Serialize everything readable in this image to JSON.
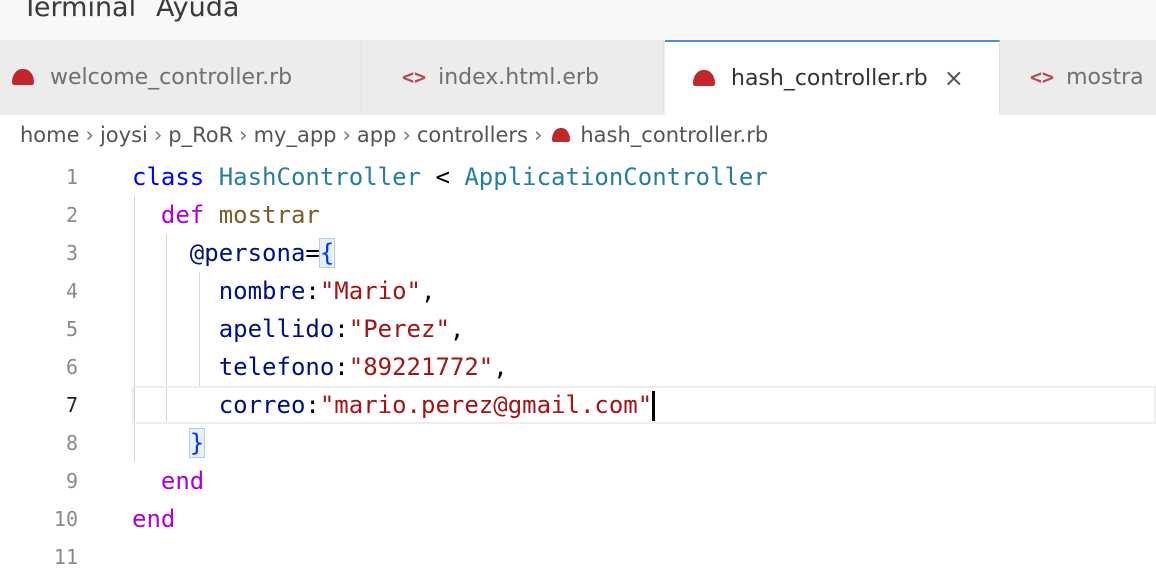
{
  "menubar": {
    "items": [
      "Terminal",
      "Ayuda"
    ]
  },
  "tabs": [
    {
      "label": "welcome_controller.rb",
      "icon": "ruby-icon",
      "active": false
    },
    {
      "label": "index.html.erb",
      "icon": "html-icon",
      "active": false
    },
    {
      "label": "hash_controller.rb",
      "icon": "ruby-icon",
      "active": true,
      "close": "×"
    },
    {
      "label": "mostra",
      "icon": "html-icon",
      "active": false
    }
  ],
  "breadcrumb": {
    "parts": [
      "home",
      "joysi",
      "p_RoR",
      "my_app",
      "app",
      "controllers"
    ],
    "file": "hash_controller.rb",
    "separator": "›"
  },
  "editor": {
    "current_line": 7,
    "lines": [
      {
        "n": "1",
        "tokens": [
          [
            "kw2",
            "class "
          ],
          [
            "cls",
            "HashController"
          ],
          [
            "pun",
            " < "
          ],
          [
            "cls",
            "ApplicationController"
          ]
        ]
      },
      {
        "n": "2",
        "tokens": [
          [
            "pun",
            "  "
          ],
          [
            "kw",
            "def "
          ],
          [
            "fn",
            "mostrar"
          ]
        ]
      },
      {
        "n": "3",
        "tokens": [
          [
            "pun",
            "    "
          ],
          [
            "var",
            "@persona"
          ],
          [
            "pun",
            "="
          ],
          [
            "brace",
            "{"
          ]
        ]
      },
      {
        "n": "4",
        "tokens": [
          [
            "pun",
            "      "
          ],
          [
            "var",
            "nombre"
          ],
          [
            "pun",
            ":"
          ],
          [
            "str",
            "\"Mario\""
          ],
          [
            "pun",
            ","
          ]
        ]
      },
      {
        "n": "5",
        "tokens": [
          [
            "pun",
            "      "
          ],
          [
            "var",
            "apellido"
          ],
          [
            "pun",
            ":"
          ],
          [
            "str",
            "\"Perez\""
          ],
          [
            "pun",
            ","
          ]
        ]
      },
      {
        "n": "6",
        "tokens": [
          [
            "pun",
            "      "
          ],
          [
            "var",
            "telefono"
          ],
          [
            "pun",
            ":"
          ],
          [
            "str",
            "\"89221772\""
          ],
          [
            "pun",
            ","
          ]
        ]
      },
      {
        "n": "7",
        "tokens": [
          [
            "pun",
            "      "
          ],
          [
            "var",
            "correo"
          ],
          [
            "pun",
            ":"
          ],
          [
            "str",
            "\"mario.perez@gmail.com\""
          ]
        ]
      },
      {
        "n": "8",
        "tokens": [
          [
            "pun",
            "    "
          ],
          [
            "brace",
            "}"
          ]
        ]
      },
      {
        "n": "9",
        "tokens": [
          [
            "pun",
            "  "
          ],
          [
            "kw",
            "end"
          ]
        ]
      },
      {
        "n": "10",
        "tokens": [
          [
            "kw",
            "end"
          ]
        ]
      },
      {
        "n": "11",
        "tokens": []
      }
    ]
  }
}
